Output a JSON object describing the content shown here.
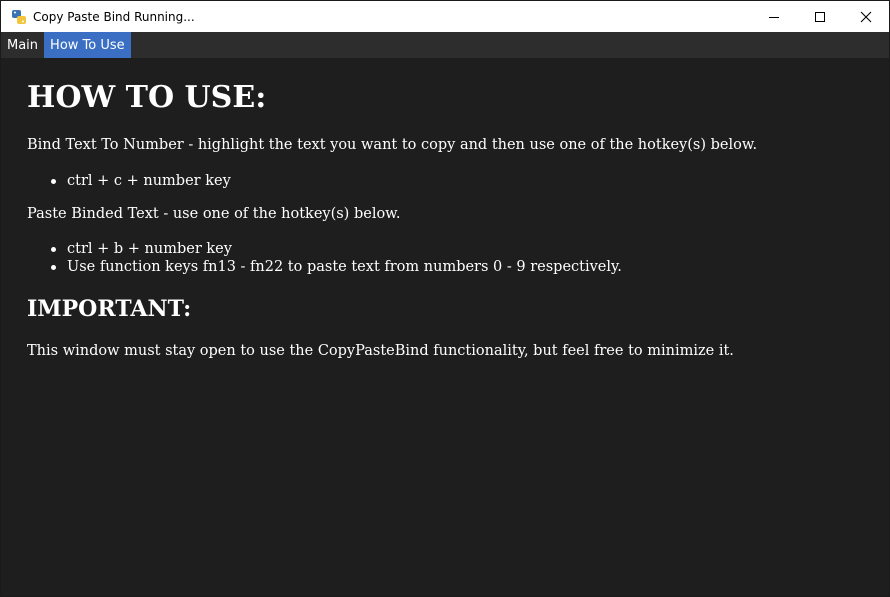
{
  "window": {
    "title": "Copy Paste Bind Running..."
  },
  "tabs": [
    {
      "label": "Main",
      "active": false
    },
    {
      "label": "How To Use",
      "active": true
    }
  ],
  "content": {
    "heading": "HOW TO USE:",
    "bind_text": "Bind Text To Number - highlight the text you want to copy and then use one of the hotkey(s) below.",
    "bind_items": [
      "ctrl + c + number key"
    ],
    "paste_text": "Paste Binded Text - use one of the hotkey(s) below.",
    "paste_items": [
      "ctrl + b + number key",
      "Use function keys fn13 - fn22 to paste text from numbers 0 - 9 respectively."
    ],
    "important_heading": "IMPORTANT:",
    "important_text": "This window must stay open to use the CopyPasteBind functionality, but feel free to minimize it."
  },
  "colors": {
    "background": "#1e1e1e",
    "tabbar": "#2d2d2d",
    "active_tab": "#3a6fc4",
    "text": "#ffffff"
  },
  "icons": {
    "app": "python-app-icon",
    "minimize": "minimize-icon",
    "maximize": "maximize-icon",
    "close": "close-icon"
  }
}
